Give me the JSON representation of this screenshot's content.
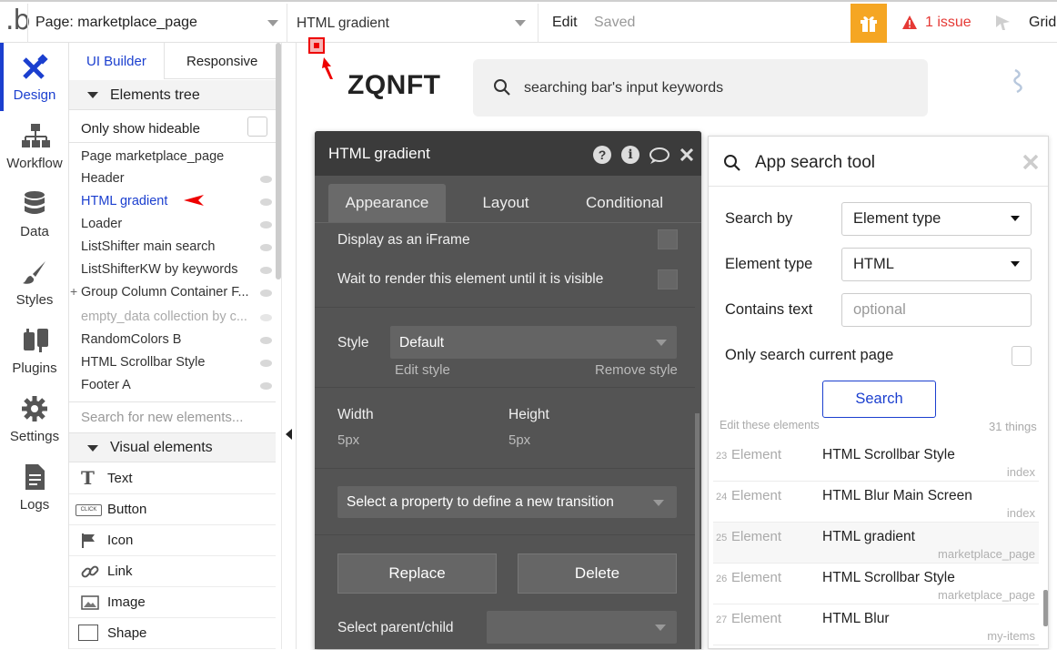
{
  "topbar": {
    "logo": ".b",
    "page_select": "Page: marketplace_page",
    "element_select": "HTML gradient",
    "edit_label": "Edit",
    "saved_label": "Saved",
    "issue_label": "1 issue",
    "grid_label": "Grid",
    "colors": {
      "gift_bg": "#f5a623",
      "issue": "#e53935"
    }
  },
  "leftnav": {
    "items": [
      {
        "label": "Design",
        "icon": "design-icon"
      },
      {
        "label": "Workflow",
        "icon": "workflow-icon"
      },
      {
        "label": "Data",
        "icon": "database-icon"
      },
      {
        "label": "Styles",
        "icon": "brush-icon"
      },
      {
        "label": "Plugins",
        "icon": "plug-icon"
      },
      {
        "label": "Settings",
        "icon": "gear-icon"
      },
      {
        "label": "Logs",
        "icon": "document-icon"
      }
    ],
    "active_color": "#1b3fcf"
  },
  "panel": {
    "tabs": [
      "UI Builder",
      "Responsive"
    ],
    "elements_tree_title": "Elements tree",
    "only_hideable": "Only show hideable",
    "tree": [
      "Page marketplace_page",
      "Header",
      "HTML gradient",
      "Loader",
      "ListShifter main search",
      "ListShifterKW by keywords",
      "Group Column Container F...",
      "empty_data collection by c...",
      "RandomColors B",
      "HTML Scrollbar Style",
      "Footer A"
    ],
    "search_placeholder": "Search for new elements...",
    "visual_elements_title": "Visual elements",
    "visual_elements": [
      {
        "label": "Text",
        "icon": "text-icon"
      },
      {
        "label": "Button",
        "icon": "button-icon",
        "icon_text": "CLICK"
      },
      {
        "label": "Icon",
        "icon": "flag-icon"
      },
      {
        "label": "Link",
        "icon": "link-icon"
      },
      {
        "label": "Image",
        "icon": "image-icon"
      },
      {
        "label": "Shape",
        "icon": "shape-icon"
      }
    ]
  },
  "canvas": {
    "brand": "ZQNFT",
    "search_placeholder": "searching bar's input keywords"
  },
  "editor": {
    "title": "HTML gradient",
    "tabs": [
      "Appearance",
      "Layout",
      "Conditional"
    ],
    "display_iframe": "Display as an iFrame",
    "wait_render": "Wait to render this element until it is visible",
    "style_label": "Style",
    "style_value": "Default",
    "edit_style": "Edit style",
    "remove_style": "Remove style",
    "width_label": "Width",
    "width_value": "5px",
    "height_label": "Height",
    "height_value": "5px",
    "transition_placeholder": "Select a property to define a new transition",
    "replace_label": "Replace",
    "delete_label": "Delete",
    "parent_child_label": "Select parent/child"
  },
  "search_tool": {
    "title": "App search tool",
    "search_by_label": "Search by",
    "search_by_value": "Element type",
    "element_type_label": "Element type",
    "element_type_value": "HTML",
    "contains_text_label": "Contains text",
    "contains_text_placeholder": "optional",
    "only_current_label": "Only search current page",
    "search_button": "Search",
    "edit_these": "Edit these elements",
    "count": "31 things",
    "results": [
      {
        "num": "23",
        "type": "Element",
        "name": "HTML Scrollbar Style",
        "page": "index"
      },
      {
        "num": "24",
        "type": "Element",
        "name": "HTML Blur Main Screen",
        "page": "index"
      },
      {
        "num": "25",
        "type": "Element",
        "name": "HTML gradient",
        "page": "marketplace_page"
      },
      {
        "num": "26",
        "type": "Element",
        "name": "HTML Scrollbar Style",
        "page": "marketplace_page"
      },
      {
        "num": "27",
        "type": "Element",
        "name": "HTML Blur",
        "page": "my-items"
      }
    ]
  }
}
